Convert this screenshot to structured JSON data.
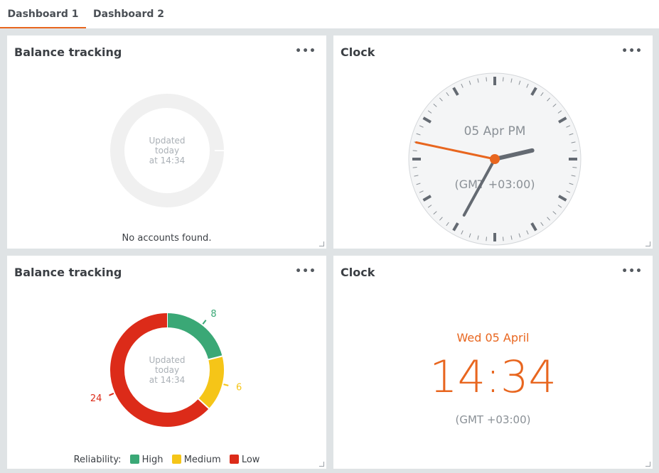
{
  "tabs": [
    {
      "label": "Dashboard 1",
      "active": true
    },
    {
      "label": "Dashboard 2",
      "active": false
    }
  ],
  "widgets": {
    "balance1": {
      "title": "Balance tracking",
      "menu": "•••",
      "center": [
        "Updated",
        "today",
        "at 14:34"
      ],
      "empty_message": "No accounts found."
    },
    "clock_analog": {
      "title": "Clock",
      "menu": "•••",
      "date_text": "05 Apr PM",
      "tz_text": "(GMT +03:00)",
      "time": {
        "hours": 14,
        "minutes": 34,
        "seconds": 47
      }
    },
    "balance2": {
      "title": "Balance tracking",
      "menu": "•••",
      "center": [
        "Updated",
        "today",
        "at 14:34"
      ],
      "legend_label": "Reliability:",
      "segments": [
        {
          "name": "High",
          "value": 8,
          "color": "#3aa876"
        },
        {
          "name": "Medium",
          "value": 6,
          "color": "#f5c518"
        },
        {
          "name": "Low",
          "value": 24,
          "color": "#dc2b19"
        }
      ]
    },
    "clock_digital": {
      "title": "Clock",
      "menu": "•••",
      "date_text": "Wed 05 April",
      "time_text": "14:34",
      "tz_text": "(GMT +03:00)"
    }
  },
  "colors": {
    "accent": "#e8661f",
    "empty_ring": "#f0f0f0",
    "clock_face": "#f4f5f6",
    "clock_hand": "#646a72"
  }
}
